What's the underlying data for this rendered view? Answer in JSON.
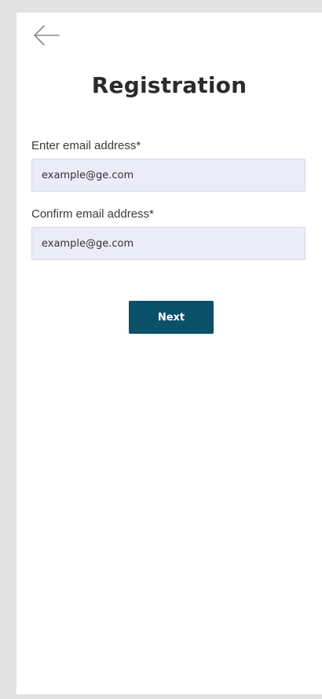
{
  "header": {
    "back_icon": "arrow-left-icon",
    "title": "Registration"
  },
  "form": {
    "email": {
      "label": "Enter email address*",
      "value": "",
      "placeholder": "example@ge.com"
    },
    "confirm_email": {
      "label": "Confirm email address*",
      "value": "",
      "placeholder": "example@ge.com"
    },
    "next_label": "Next"
  },
  "colors": {
    "primary_button": "#0a5069",
    "input_background": "#ecebf8",
    "page_background": "#ffffff",
    "frame_background": "#e2e2e2"
  }
}
